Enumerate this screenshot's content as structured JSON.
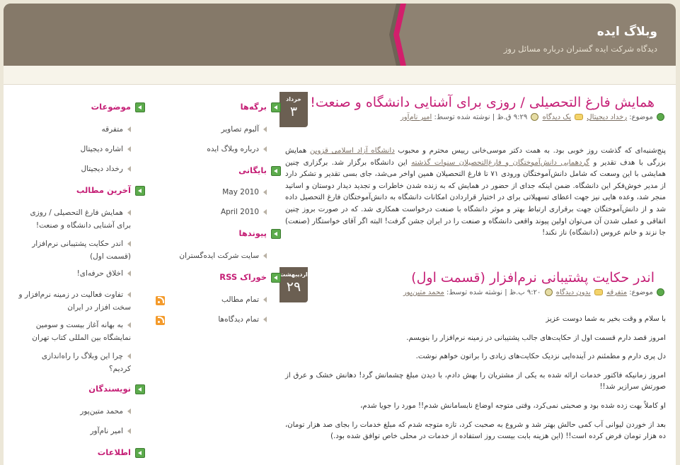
{
  "header": {
    "title": "وبلاگ ایده",
    "tagline": "دیدگاه شرکت ایده گستران درباره مسائل روز"
  },
  "colors": {
    "accent": "#c51f76",
    "header_bg": "#8e8272",
    "badge_bg": "#6b5f52",
    "widget_icon": "#5cab4c"
  },
  "posts": [
    {
      "date_month": "خرداد",
      "date_day": "۳",
      "title": "همایش فارغ التحصیلی / روزی برای آشنایی دانشگاه و صنعت!",
      "meta": {
        "topic_label": "موضوع:",
        "category": "رخداد دیجیتال",
        "comments": "یک دیدگاه",
        "time": "۹:۲۹ ق.ظ",
        "author_label": "| نوشته شده توسط:",
        "author": "امیر نام‌آور"
      },
      "body": [
        {
          "before": "پنج‌شنبه‌ای که گذشت روز خوبی بود. به همت دکتر موسی‌خانی رییس محترم و محبوب ",
          "link": "دانشگاه آزاد اسلامی قزوین",
          "middle": " همایش بزرگی با هدف تقدیر و ",
          "link2": "گردهمایی دانش‌آموختگان و فارغ‌التحصیلان سنوات گذشته",
          "after": " این دانشگاه برگزار شد. برگزاری چنین همایشی با این وسعت که شامل دانش‌آموختگان ورودی ۷۱ تا فارغ التحصیلان همین اواخر می‌شد، جای بسی تقدیر و تشکر دارد از مدیر خوش‌فکر این دانشگاه. ضمن اینکه جدای از حضور در همایش که به زنده شدن خاطرات و تجدید دیدار دوستان و اساتید منجر شد، وعده هایی نیز جهت اعطای تسهیلاتی برای در اختیار قراردادن امکانات دانشگاه به دانش‌آموختگان فارغ التحصیل داده شد و از دانش‌آموختگان جهت برقراری ارتباط بهتر و موثر دانشگاه با صنعت درخواست همکاری شد. که در صورت بروز چنین اتفاقی و عملی شدن آن می‌توان اولین پیوند واقعی دانشگاه و صنعت را در ایران جشن گرفت! البته اگر آقای خواستگار (صنعت) جا نزند و خانم عروس (دانشگاه) ناز نکند!"
        }
      ]
    },
    {
      "date_month": "اردیبهشت",
      "date_day": "۲۹",
      "title": "اندر حکایت پشتیبانی نرم‌افزار (قسمت اول)",
      "meta": {
        "topic_label": "موضوع:",
        "category": "متفرقه",
        "comments": "بدون دیدگاه",
        "time": "۹:۲۰ ب.ظ",
        "author_label": "| نوشته شده توسط:",
        "author": "محمد متین‌پور"
      },
      "paragraphs": [
        "با سلام و وقت بخیر به شما دوست عزیز",
        "امروز قصد دارم  قسمت اول از حکایت‌های جالب پشتیبانی در زمینه نرم‌افزار را بنویسم.",
        "دل پری دارم و مطمئنم در آینده‌ایی نزدیک حکایت‌های زیادی را براتون خواهم نوشت.",
        "امروز زمانیکه فاکتور خدمات ارائه شده به یکی از مشتریان را بهش دادم، با دیدن مبلغ چشمانش گرد! دهانش خشک و عرق از صورتش سرازیر شد!!",
        "او کاملاً بهت زده شده بود و صحبتی نمی‌کرد، وقتی متوجه اوضاع نابسامانش شدم!! مورد را جویا شدم،",
        "بعد از خوردن لیوانی آب کمی حالش بهتر شد و شروع به صحبت کرد، تازه متوجه شدم که مبلغ خدمات را بجای صد هزار تومان، ده هزار تومان فرض کرده است!! (این هزینه بابت بیست روز استفاده از خدمات در محلی خاص توافق شده بود.)"
      ]
    }
  ],
  "sidebar_mid": {
    "pages": {
      "title": "برگه‌ها",
      "items": [
        "آلبوم تصاویر",
        "درباره وبلاگ ایده"
      ]
    },
    "archive": {
      "title": "بایگانی",
      "items": [
        "May 2010",
        "April 2010"
      ]
    },
    "links": {
      "title": "پیوندها",
      "items": [
        "سایت شرکت ایده‌گستران"
      ]
    },
    "rss": {
      "title": "خوراک RSS",
      "items": [
        "تمام مطالب",
        "تمام دیدگاه‌ها"
      ]
    }
  },
  "sidebar_left": {
    "topics": {
      "title": "موضوعات",
      "items": [
        "متفرقه",
        "اشاره دیجیتال",
        "رخداد دیجیتال"
      ]
    },
    "recent": {
      "title": "آخرین مطالب",
      "items": [
        "همایش فارغ التحصیلی / روزی برای آشنایی دانشگاه و صنعت!",
        "اندر حکایت پشتیبانی نرم‌افزار (قسمت اول)",
        "اخلاق حرفه‌ای!",
        "تفاوت فعالیت در زمینه نرم‌افزار و سخت افزار در ایران",
        "به بهانه آغاز بیست و سومین نمایشگاه بین المللی کتاب تهران",
        "چرا این وبلاگ را راه‌اندازی کردیم؟"
      ]
    },
    "authors": {
      "title": "نویسندگان",
      "items": [
        "محمد متین‌پور",
        "امیر نام‌آور"
      ]
    },
    "info": {
      "title": "اطلاعات"
    }
  }
}
